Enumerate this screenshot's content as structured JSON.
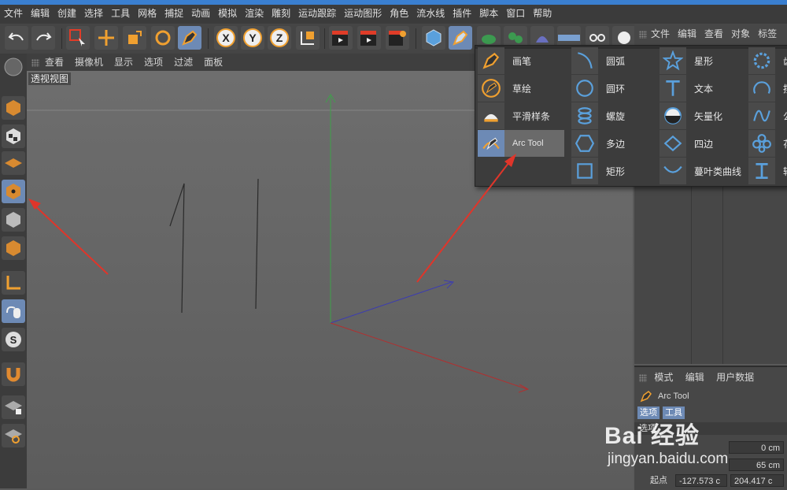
{
  "menubar": [
    "文件",
    "编辑",
    "创建",
    "选择",
    "工具",
    "网格",
    "捕捉",
    "动画",
    "模拟",
    "渲染",
    "雕刻",
    "运动跟踪",
    "运动图形",
    "角色",
    "流水线",
    "插件",
    "脚本",
    "窗口",
    "帮助"
  ],
  "viewport": {
    "menu": [
      "查看",
      "摄像机",
      "显示",
      "选项",
      "过滤",
      "面板"
    ],
    "title": "透视视图"
  },
  "object_panel": {
    "menu": [
      "文件",
      "编辑",
      "查看",
      "对象",
      "标签"
    ]
  },
  "dropdown": {
    "col1": [
      "画笔",
      "草绘",
      "平滑样条",
      "Arc Tool"
    ],
    "col2": [
      "圆弧",
      "圆环",
      "螺旋",
      "多边",
      "矩形"
    ],
    "col3": [
      "星形",
      "文本",
      "矢量化",
      "四边",
      "蔓叶类曲线"
    ],
    "col4": [
      "齿",
      "摆",
      "公",
      "花",
      "轮"
    ],
    "highlighted": "Arc Tool"
  },
  "attributes": {
    "menu": [
      "模式",
      "编辑",
      "用户数据"
    ],
    "object_name": "Arc Tool",
    "tabs": [
      "选项",
      "工具"
    ],
    "section": "选项",
    "fields": {
      "field1": "0 cm",
      "field2": "65 cm",
      "start_label": "起点",
      "start_x": "-127.573 c",
      "start_y": "204.417 c"
    }
  },
  "watermark": {
    "brand": "Bai 经验",
    "url": "jingyan.baidu.com"
  },
  "colors": {
    "accent": "#3a7fd0",
    "selected": "#6d8ab5",
    "orange": "#f0a030",
    "arrow_red": "#e0352a",
    "axis_y": "#3fa04a",
    "axis_x": "#b03030",
    "axis_z": "#3c3cb0"
  }
}
